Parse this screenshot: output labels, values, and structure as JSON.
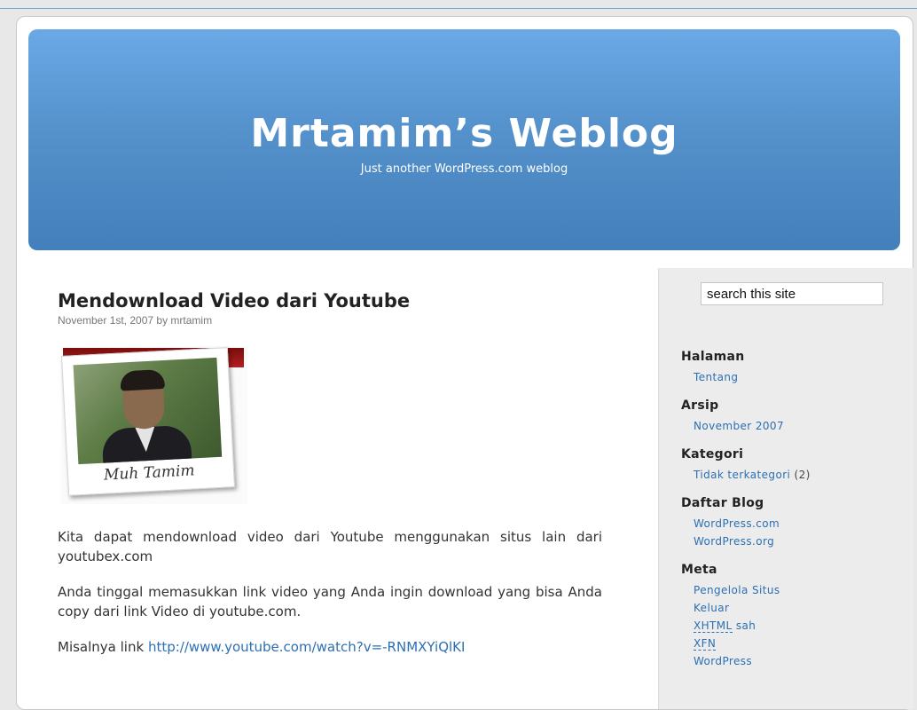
{
  "header": {
    "title": "Mrtamim’s Weblog",
    "description": "Just another WordPress.com weblog"
  },
  "post": {
    "title": "Mendownload Video dari Youtube",
    "meta": "November 1st, 2007 by mrtamim",
    "image_caption": "Muh Tamim",
    "paragraphs": [
      "Kita dapat mendownload video dari Youtube menggunakan situs lain dari youtubex.com",
      "Anda tinggal memasukkan link video yang Anda ingin download yang bisa Anda copy dari link Video di youtube.com."
    ],
    "example_prefix": "Misalnya link ",
    "example_link": "http://www.youtube.com/watch?v=-RNMXYiQlKI"
  },
  "sidebar": {
    "search_value": "search this site",
    "widgets": {
      "halaman": {
        "title": "Halaman",
        "items": [
          "Tentang"
        ]
      },
      "arsip": {
        "title": "Arsip",
        "items": [
          "November 2007"
        ]
      },
      "kategori": {
        "title": "Kategori",
        "item": "Tidak terkategori",
        "count": "(2)"
      },
      "daftar_blog": {
        "title": "Daftar Blog",
        "items": [
          "WordPress.com",
          "WordPress.org"
        ]
      },
      "meta": {
        "title": "Meta",
        "items": [
          "Pengelola Situs",
          "Keluar",
          "XHTML sah",
          "XFN",
          "WordPress"
        ]
      }
    }
  },
  "colors": {
    "header_gradient_top": "#69a9e6",
    "header_gradient_bottom": "#437fba",
    "link": "#2c6fb3",
    "sidebar_bg": "#ececec"
  }
}
